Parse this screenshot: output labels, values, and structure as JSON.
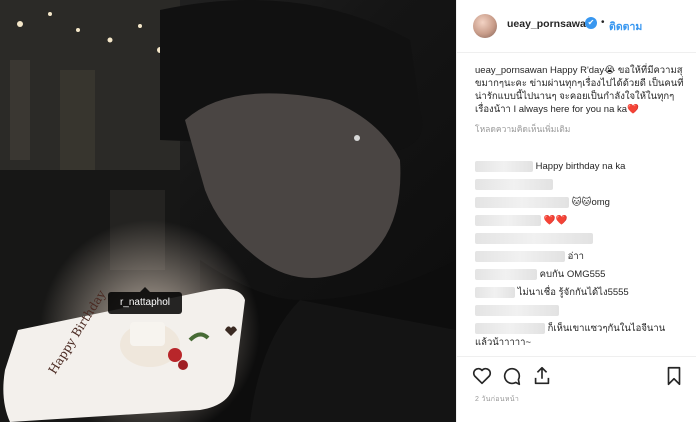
{
  "photo": {
    "tag_label": "r_nattaphol",
    "plate_text": "Happy Birthday"
  },
  "header": {
    "username": "ueay_pornsawan",
    "verified_mark": "✔",
    "separator": "•",
    "follow_label": "ติดตาม"
  },
  "caption": {
    "username": "ueay_pornsawan",
    "text": "Happy R'day😭 ขอให้ที่มีความสุขมากๆนะคะ ข่ามผ่านทุกๆเรื่องไปได้ด้วยดี เป็นคนที่น่ารักแบบนี้ไปนานๆ จะคอยเป็นกำลังใจให้ในทุกๆเรื่องน้าา I always here for you na ka❤️"
  },
  "more_comments_label": "โหลดความคิดเห็นเพิ่มเติม",
  "comments": [
    {
      "text": "Happy birthday na ka"
    },
    {
      "text": ""
    },
    {
      "text": "🐱🐱omg"
    },
    {
      "text": "❤️❤️"
    },
    {
      "text": ""
    },
    {
      "text": "อ่าา"
    },
    {
      "text": "คบกัน OMG555"
    },
    {
      "text": "ไม่นาเชื่อ รู้จักกันได้ไง5555"
    },
    {
      "text": ""
    },
    {
      "text": "ก็เห็นเขาแซวๆกันในไอจีนาน"
    },
    {
      "text": "แล้วน้าาาาา~"
    }
  ],
  "date_label": "2 วันก่อนหน้า",
  "colors": {
    "accent": "#3897f0",
    "text": "#262626",
    "muted": "#999999",
    "border": "#efefef"
  },
  "icons": [
    "heart-icon",
    "comment-icon",
    "share-icon",
    "bookmark-icon"
  ]
}
